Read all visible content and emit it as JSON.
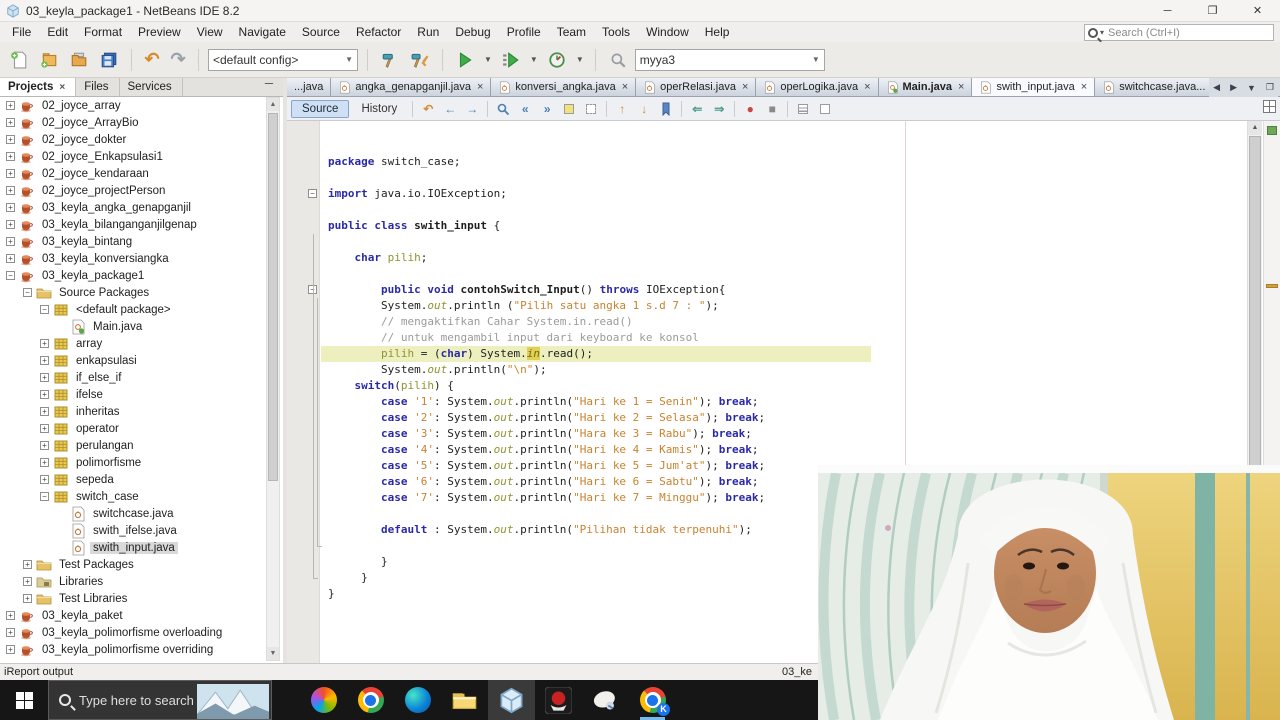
{
  "window": {
    "title": "03_keyla_package1 - NetBeans IDE 8.2",
    "controls": {
      "minimize": "─",
      "maximize": "❐",
      "close": "✕"
    }
  },
  "menubar": {
    "items": [
      "File",
      "Edit",
      "Format",
      "Preview",
      "View",
      "Navigate",
      "Source",
      "Refactor",
      "Run",
      "Debug",
      "Profile",
      "Team",
      "Tools",
      "Window",
      "Help"
    ],
    "search_placeholder": "Search (Ctrl+I)"
  },
  "toolbar": {
    "file_icons": [
      "new-file",
      "new-project",
      "open-project",
      "save-all"
    ],
    "edit_icons": [
      "undo",
      "redo"
    ],
    "config_value": "<default config>",
    "build_icons": [
      "build-project",
      "clean-and-build"
    ],
    "run_icons": [
      "run-project",
      "debug-project",
      "profile-project"
    ],
    "search_icon": "search-projects",
    "project_value": "myya3"
  },
  "panel": {
    "tabs": [
      {
        "label": "Projects",
        "closable": true,
        "selected": true
      },
      {
        "label": "Files",
        "closable": false,
        "selected": false
      },
      {
        "label": "Services",
        "closable": false,
        "selected": false
      }
    ],
    "tree": [
      {
        "label": "02_joyce_array",
        "level": 0,
        "handle": "plus",
        "icon": "project"
      },
      {
        "label": "02_joyce_ArrayBio",
        "level": 0,
        "handle": "plus",
        "icon": "project"
      },
      {
        "label": "02_joyce_dokter",
        "level": 0,
        "handle": "plus",
        "icon": "project"
      },
      {
        "label": "02_joyce_Enkapsulasi1",
        "level": 0,
        "handle": "plus",
        "icon": "project"
      },
      {
        "label": "02_joyce_kendaraan",
        "level": 0,
        "handle": "plus",
        "icon": "project"
      },
      {
        "label": "02_joyce_projectPerson",
        "level": 0,
        "handle": "plus",
        "icon": "project"
      },
      {
        "label": "03_keyla_angka_genapganjil",
        "level": 0,
        "handle": "plus",
        "icon": "project"
      },
      {
        "label": "03_keyla_bilanganganjilgenap",
        "level": 0,
        "handle": "plus",
        "icon": "project"
      },
      {
        "label": "03_keyla_bintang",
        "level": 0,
        "handle": "plus",
        "icon": "project"
      },
      {
        "label": "03_keyla_konversiangka",
        "level": 0,
        "handle": "plus",
        "icon": "project"
      },
      {
        "label": "03_keyla_package1",
        "level": 0,
        "handle": "minus",
        "icon": "project"
      },
      {
        "label": "Source Packages",
        "level": 1,
        "handle": "minus",
        "icon": "folder"
      },
      {
        "label": "<default package>",
        "level": 2,
        "handle": "minus",
        "icon": "package"
      },
      {
        "label": "Main.java",
        "level": 3,
        "handle": "none",
        "icon": "mainjava"
      },
      {
        "label": "array",
        "level": 2,
        "handle": "plus",
        "icon": "package"
      },
      {
        "label": "enkapsulasi",
        "level": 2,
        "handle": "plus",
        "icon": "package"
      },
      {
        "label": "if_else_if",
        "level": 2,
        "handle": "plus",
        "icon": "package"
      },
      {
        "label": "ifelse",
        "level": 2,
        "handle": "plus",
        "icon": "package"
      },
      {
        "label": "inheritas",
        "level": 2,
        "handle": "plus",
        "icon": "package"
      },
      {
        "label": "operator",
        "level": 2,
        "handle": "plus",
        "icon": "package"
      },
      {
        "label": "perulangan",
        "level": 2,
        "handle": "plus",
        "icon": "package"
      },
      {
        "label": "polimorfisme",
        "level": 2,
        "handle": "plus",
        "icon": "package"
      },
      {
        "label": "sepeda",
        "level": 2,
        "handle": "plus",
        "icon": "package"
      },
      {
        "label": "switch_case",
        "level": 2,
        "handle": "minus",
        "icon": "package"
      },
      {
        "label": "switchcase.java",
        "level": 3,
        "handle": "none",
        "icon": "java"
      },
      {
        "label": "swith_ifelse.java",
        "level": 3,
        "handle": "none",
        "icon": "java"
      },
      {
        "label": "swith_input.java",
        "level": 3,
        "handle": "none",
        "icon": "java",
        "selected": true
      },
      {
        "label": "Test Packages",
        "level": 1,
        "handle": "plus",
        "icon": "folder"
      },
      {
        "label": "Libraries",
        "level": 1,
        "handle": "plus",
        "icon": "libfolder"
      },
      {
        "label": "Test Libraries",
        "level": 1,
        "handle": "plus",
        "icon": "folder"
      },
      {
        "label": "03_keyla_paket",
        "level": 0,
        "handle": "plus",
        "icon": "project"
      },
      {
        "label": "03_keyla_polimorfisme overloading",
        "level": 0,
        "handle": "plus",
        "icon": "project"
      },
      {
        "label": "03_keyla_polimorfisme overriding",
        "level": 0,
        "handle": "plus",
        "icon": "project"
      }
    ]
  },
  "editor": {
    "tabs": [
      {
        "label": "...java",
        "icon": false,
        "close": false
      },
      {
        "label": "angka_genapganjil.java",
        "icon": true,
        "close": true
      },
      {
        "label": "konversi_angka.java",
        "icon": true,
        "close": true
      },
      {
        "label": "operRelasi.java",
        "icon": true,
        "close": true
      },
      {
        "label": "operLogika.java",
        "icon": true,
        "close": true
      },
      {
        "label": "Main.java",
        "icon": true,
        "close": true,
        "bold": true,
        "main": true
      },
      {
        "label": "swith_input.java",
        "icon": true,
        "close": true,
        "selected": true
      },
      {
        "label": "switchcase.java...",
        "icon": true,
        "close": false
      }
    ],
    "tab_nav_icons": [
      "scroll-tabs-left",
      "scroll-tabs-right",
      "tab-list",
      "maximize-window"
    ],
    "source_label": "Source",
    "history_label": "History",
    "toolbar_icons": [
      "last-edit",
      "back",
      "forward",
      "find-selection",
      "find-previous",
      "find-next",
      "toggle-highlight-search",
      "toggle-rectangular-selection",
      "previous-bookmark",
      "next-bookmark",
      "toggle-bookmark",
      "shift-line-left",
      "shift-line-right",
      "start-macro-recording",
      "stop-macro-recording",
      "comment",
      "uncomment"
    ],
    "code_lines": [
      {
        "segs": []
      },
      {
        "segs": [
          [
            "k",
            "package"
          ],
          [
            "d",
            " switch_case;"
          ]
        ]
      },
      {
        "segs": []
      },
      {
        "segs": [
          [
            "k",
            "import"
          ],
          [
            "d",
            " java.io.IOException;"
          ]
        ],
        "fold": true
      },
      {
        "segs": []
      },
      {
        "segs": [
          [
            "k",
            "public"
          ],
          [
            "d",
            " "
          ],
          [
            "k",
            "class"
          ],
          [
            "d",
            " "
          ],
          [
            "b",
            "swith_input"
          ],
          [
            "d",
            " {"
          ]
        ]
      },
      {
        "segs": []
      },
      {
        "segs": [
          [
            "d",
            "    "
          ],
          [
            "k",
            "char"
          ],
          [
            "d",
            " "
          ],
          [
            "f",
            "pilih"
          ],
          [
            "d",
            ";"
          ]
        ]
      },
      {
        "segs": []
      },
      {
        "segs": [
          [
            "d",
            "        "
          ],
          [
            "k",
            "public"
          ],
          [
            "d",
            " "
          ],
          [
            "k",
            "void"
          ],
          [
            "d",
            " "
          ],
          [
            "b",
            "contohSwitch_Input"
          ],
          [
            "d",
            "() "
          ],
          [
            "k",
            "throws"
          ],
          [
            "d",
            " IOException{"
          ]
        ],
        "fold": true
      },
      {
        "segs": [
          [
            "d",
            "        System."
          ],
          [
            "m",
            "out"
          ],
          [
            "d",
            ".println ("
          ],
          [
            "s",
            "\"Pilih satu angka 1 s.d 7 : \""
          ],
          [
            "d",
            ");"
          ]
        ]
      },
      {
        "segs": [
          [
            "c",
            "        // mengaktifkan Cahar System.in.read()"
          ]
        ]
      },
      {
        "segs": [
          [
            "c",
            "        // untuk mengambil input dari keyboard ke konsol"
          ]
        ]
      },
      {
        "segs": [
          [
            "d",
            "        "
          ],
          [
            "f",
            "pilih"
          ],
          [
            "d",
            " = ("
          ],
          [
            "k",
            "char"
          ],
          [
            "d",
            ") System."
          ],
          [
            "hi",
            "in"
          ],
          [
            "d",
            ".read();"
          ]
        ],
        "highlight": true
      },
      {
        "segs": [
          [
            "d",
            "        System."
          ],
          [
            "m",
            "out"
          ],
          [
            "d",
            ".println("
          ],
          [
            "s",
            "\"\\n\""
          ],
          [
            "d",
            ");"
          ]
        ]
      },
      {
        "segs": [
          [
            "d",
            "    "
          ],
          [
            "k",
            "switch"
          ],
          [
            "d",
            "("
          ],
          [
            "f",
            "pilih"
          ],
          [
            "d",
            ") {"
          ]
        ]
      },
      {
        "segs": [
          [
            "d",
            "        "
          ],
          [
            "k",
            "case"
          ],
          [
            "d",
            " "
          ],
          [
            "s",
            "'1'"
          ],
          [
            "d",
            ": System."
          ],
          [
            "m",
            "out"
          ],
          [
            "d",
            ".println("
          ],
          [
            "s",
            "\"Hari ke 1 = Senin\""
          ],
          [
            "d",
            "); "
          ],
          [
            "k",
            "break"
          ],
          [
            "d",
            ";"
          ]
        ]
      },
      {
        "segs": [
          [
            "d",
            "        "
          ],
          [
            "k",
            "case"
          ],
          [
            "d",
            " "
          ],
          [
            "s",
            "'2'"
          ],
          [
            "d",
            ": System."
          ],
          [
            "m",
            "out"
          ],
          [
            "d",
            ".println("
          ],
          [
            "s",
            "\"Hari ke 2 = Selasa\""
          ],
          [
            "d",
            "); "
          ],
          [
            "k",
            "break"
          ],
          [
            "d",
            ";"
          ]
        ]
      },
      {
        "segs": [
          [
            "d",
            "        "
          ],
          [
            "k",
            "case"
          ],
          [
            "d",
            " "
          ],
          [
            "s",
            "'3'"
          ],
          [
            "d",
            ": System."
          ],
          [
            "m",
            "out"
          ],
          [
            "d",
            ".println("
          ],
          [
            "s",
            "\"Hara ke 3 = Rabu\""
          ],
          [
            "d",
            "); "
          ],
          [
            "k",
            "break"
          ],
          [
            "d",
            ";"
          ]
        ]
      },
      {
        "segs": [
          [
            "d",
            "        "
          ],
          [
            "k",
            "case"
          ],
          [
            "d",
            " "
          ],
          [
            "s",
            "'4'"
          ],
          [
            "d",
            ": System."
          ],
          [
            "m",
            "out"
          ],
          [
            "d",
            ".println("
          ],
          [
            "s",
            "\"Hari ke 4 = Kamis\""
          ],
          [
            "d",
            "); "
          ],
          [
            "k",
            "break"
          ],
          [
            "d",
            ";"
          ]
        ]
      },
      {
        "segs": [
          [
            "d",
            "        "
          ],
          [
            "k",
            "case"
          ],
          [
            "d",
            " "
          ],
          [
            "s",
            "'5'"
          ],
          [
            "d",
            ": System."
          ],
          [
            "m",
            "out"
          ],
          [
            "d",
            ".println("
          ],
          [
            "s",
            "\"Hari ke 5 = Jum'at\""
          ],
          [
            "d",
            "); "
          ],
          [
            "k",
            "break"
          ],
          [
            "d",
            ";"
          ]
        ]
      },
      {
        "segs": [
          [
            "d",
            "        "
          ],
          [
            "k",
            "case"
          ],
          [
            "d",
            " "
          ],
          [
            "s",
            "'6'"
          ],
          [
            "d",
            ": System."
          ],
          [
            "m",
            "out"
          ],
          [
            "d",
            ".println("
          ],
          [
            "s",
            "\"Hari ke 6 = Sabtu\""
          ],
          [
            "d",
            "); "
          ],
          [
            "k",
            "break"
          ],
          [
            "d",
            ";"
          ]
        ]
      },
      {
        "segs": [
          [
            "d",
            "        "
          ],
          [
            "k",
            "case"
          ],
          [
            "d",
            " "
          ],
          [
            "s",
            "'7'"
          ],
          [
            "d",
            ": System."
          ],
          [
            "m",
            "out"
          ],
          [
            "d",
            ".println("
          ],
          [
            "s",
            "\"Hari ke 7 = Minggu\""
          ],
          [
            "d",
            "); "
          ],
          [
            "k",
            "break"
          ],
          [
            "d",
            ";"
          ]
        ]
      },
      {
        "segs": []
      },
      {
        "segs": [
          [
            "d",
            "        "
          ],
          [
            "k",
            "default"
          ],
          [
            "d",
            " : System."
          ],
          [
            "m",
            "out"
          ],
          [
            "d",
            ".println("
          ],
          [
            "s",
            "\"Pilihan tidak terpenuhi\""
          ],
          [
            "d",
            ");"
          ]
        ]
      },
      {
        "segs": []
      },
      {
        "segs": [
          [
            "d",
            "        }"
          ]
        ]
      },
      {
        "segs": [
          [
            "d",
            "     }"
          ]
        ]
      },
      {
        "segs": [
          [
            "d",
            "}"
          ]
        ]
      }
    ]
  },
  "statusbar": {
    "left": "iReport output",
    "right": "03_ke"
  },
  "taskbar": {
    "search_placeholder": "Type here to search",
    "items": [
      {
        "name": "copilot"
      },
      {
        "name": "chrome"
      },
      {
        "name": "edge"
      },
      {
        "name": "file-explorer"
      },
      {
        "name": "netbeans",
        "active": "tile"
      },
      {
        "name": "screen-recorder"
      },
      {
        "name": "camera-app"
      },
      {
        "name": "chrome-profile-k",
        "active": "underline",
        "badge": "K"
      }
    ]
  },
  "colors": {
    "keyword_blue": "#2a2aa8",
    "string_orange": "#c9822e",
    "comment_gray": "#9b9b9b",
    "field_olive": "#8f9430",
    "current_line_highlight": "#edefbe",
    "occurrence_highlight": "#e3cf52",
    "run_green": "#3fae49",
    "taskbar_black": "#161616",
    "active_underline_blue": "#76b9ed",
    "error_stripe_ok_green": "#6fa857"
  }
}
